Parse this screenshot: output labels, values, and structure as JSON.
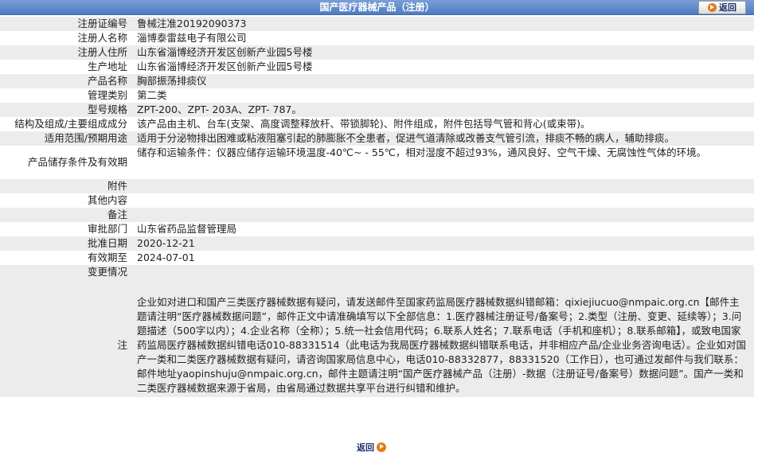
{
  "header": {
    "title": "国产医疗器械产品（注册）",
    "back_label": "返回"
  },
  "rows": [
    {
      "label": "注册证编号",
      "value": "鲁械注准20192090373"
    },
    {
      "label": "注册人名称",
      "value": "淄博泰雷兹电子有限公司"
    },
    {
      "label": "注册人住所",
      "value": "山东省淄博经济开发区创新产业园5号楼"
    },
    {
      "label": "生产地址",
      "value": "山东省淄博经济开发区创新产业园5号楼"
    },
    {
      "label": "产品名称",
      "value": "胸部振荡排痰仪"
    },
    {
      "label": "管理类别",
      "value": "第二类"
    },
    {
      "label": "型号规格",
      "value": "ZPT-200、ZPT- 203A、ZPT- 787。"
    },
    {
      "label": "结构及组成/主要组成成分",
      "value": "该产品由主机、台车(支架、高度调整释放杆、带锁脚轮)、附件组成，附件包括导气管和背心(或束带)。"
    },
    {
      "label": "适用范围/预期用途",
      "value": "适用于分泌物排出困难或粘液阻塞引起的肺膨胀不全患者，促进气道清除或改善支气管引流，排痰不畅的病人，辅助排痰。"
    },
    {
      "label": "产品储存条件及有效期",
      "value": "储存和运输条件：仪器应储存运输环境温度-40℃~ - 55℃，相对湿度不超过93%，通风良好、空气干燥、无腐蚀性气体的环境。"
    },
    {
      "label": "附件",
      "value": ""
    },
    {
      "label": "其他内容",
      "value": ""
    },
    {
      "label": "备注",
      "value": ""
    },
    {
      "label": "审批部门",
      "value": "山东省药品监督管理局"
    },
    {
      "label": "批准日期",
      "value": "2020-12-21"
    },
    {
      "label": "有效期至",
      "value": "2024-07-01"
    },
    {
      "label": "变更情况",
      "value": ""
    },
    {
      "label": "注",
      "value": "企业如对进口和国产三类医疗器械数据有疑问，请发送邮件至国家药监局医疗器械数据纠错邮箱：qixiejiucuo@nmpaic.org.cn【邮件主题请注明“医疗器械数据问题”，邮件正文中请准确填写以下全部信息：1.医疗器械注册证号/备案号；2.类型（注册、变更、延续等）；3.问题描述（500字以内）；4.企业名称（全称）；5.统一社会信用代码；6.联系人姓名；7.联系电话（手机和座机）；8.联系邮箱】，或致电国家药监局医疗器械数据纠错电话010-88331514（此电话为我局医疗器械数据纠错联系电话，并非相应产品/企业业务咨询电话）。企业如对国产一类和二类医疗器械数据有疑问，请咨询国家局信息中心，电话010-88332877，88331520（工作日），也可通过发邮件与我们联系：邮件地址yaopinshuju@nmpaic.org.cn，邮件主题请注明“国产医疗器械产品（注册）-数据（注册证号/备案号）数据问题”。国产一类和二类医疗器械数据来源于省局，由省局通过数据共享平台进行纠错和维护。"
    }
  ],
  "footer": {
    "back_label": "返回"
  },
  "colors": {
    "header_bg": "#5a84c8",
    "row_alt": "#ececec",
    "accent": "#e07b16"
  }
}
